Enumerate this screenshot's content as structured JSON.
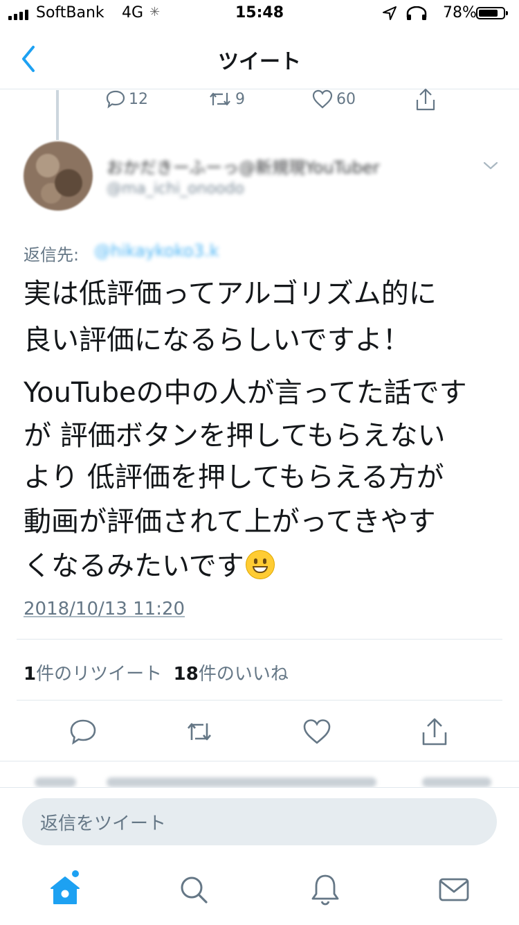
{
  "status_bar": {
    "carrier": "SoftBank",
    "network": "4G",
    "time": "15:48",
    "battery": "78%"
  },
  "nav": {
    "title": "ツイート",
    "back_icon": "chevron-left-icon"
  },
  "prev_tweet_actions": {
    "replies": "12",
    "retweets": "9",
    "likes": "60"
  },
  "author": {
    "name": "おかだきーふーっ@新規現YouTuber",
    "handle": "@ma_ichi_onoodo"
  },
  "reply_to": {
    "label": "返信先:",
    "handle": "@hikaykoko3.k"
  },
  "tweet": {
    "lines": [
      "実は低評価ってアルゴリズム的に",
      "良い評価になるらしいですよ！",
      "YouTubeの中の人が言ってた話です",
      "が 評価ボタンを押してもらえない",
      "より 低評価を押してもらえる方が",
      "動画が評価されて上がってきやす",
      "くなるみたいです"
    ],
    "emoji": "grinning-face",
    "timestamp": "2018/10/13 11:20"
  },
  "stats": {
    "retweet_count": "1",
    "retweet_label": "件のリツイート",
    "like_count": "18",
    "like_label": "件のいいね"
  },
  "actions": [
    "reply-icon",
    "retweet-icon",
    "like-icon",
    "share-icon"
  ],
  "composer": {
    "placeholder": "返信をツイート"
  },
  "tabbar": [
    "home-icon",
    "search-icon",
    "notifications-icon",
    "messages-icon"
  ],
  "colors": {
    "accent": "#1da1f2",
    "muted": "#657786",
    "divider": "#e1e8ed"
  }
}
